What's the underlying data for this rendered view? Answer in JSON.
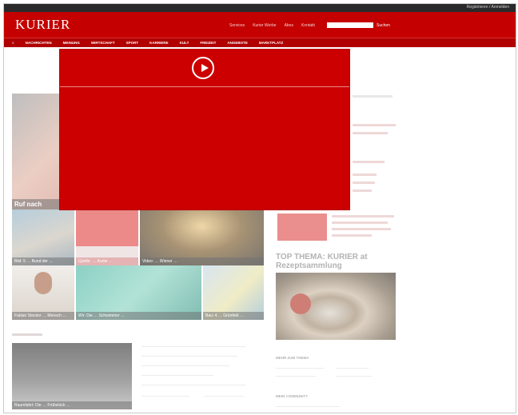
{
  "header": {
    "logo": "KURIER",
    "util_link": "Registrieren / Anmelden",
    "top_links": [
      "Services",
      "Kurier Werbe",
      "Abos",
      "Kontakt"
    ],
    "search_button": "Suchen",
    "nav": [
      "≡",
      "NACHRICHTEN",
      "MEINUNG",
      "WIRTSCHAFT",
      "SPORT",
      "KARRIERE",
      "KULT",
      "FREIZEIT",
      "ANGEBOTE",
      "MARKTPLATZ"
    ]
  },
  "teasers": [
    {
      "caption": "Ruf nach"
    },
    {
      "caption": "Bild: 5 … Bund der …"
    },
    {
      "caption": "Quelle: … Kurier …"
    },
    {
      "caption": "Video: … Wiener …"
    },
    {
      "caption": "Fabian Stocker … Mensch …"
    },
    {
      "caption": "Wir: Die … Schwimmer …"
    },
    {
      "caption": "Bau: 4 … Grünfeld …"
    },
    {
      "caption": "Raumfahrt: Die … Frühstück …"
    }
  ],
  "top_thema": {
    "title": "TOP THEMA: KURIER at Rezeptsammlung"
  },
  "side_headings": {
    "themen": "MEHR ZUM THEMA",
    "community": "MEIN COMMUNITY"
  },
  "player": {
    "icon": "play-icon"
  },
  "colors": {
    "brand": "#cc0000",
    "nav": "#b00000",
    "topbar": "#2a2a2a"
  }
}
